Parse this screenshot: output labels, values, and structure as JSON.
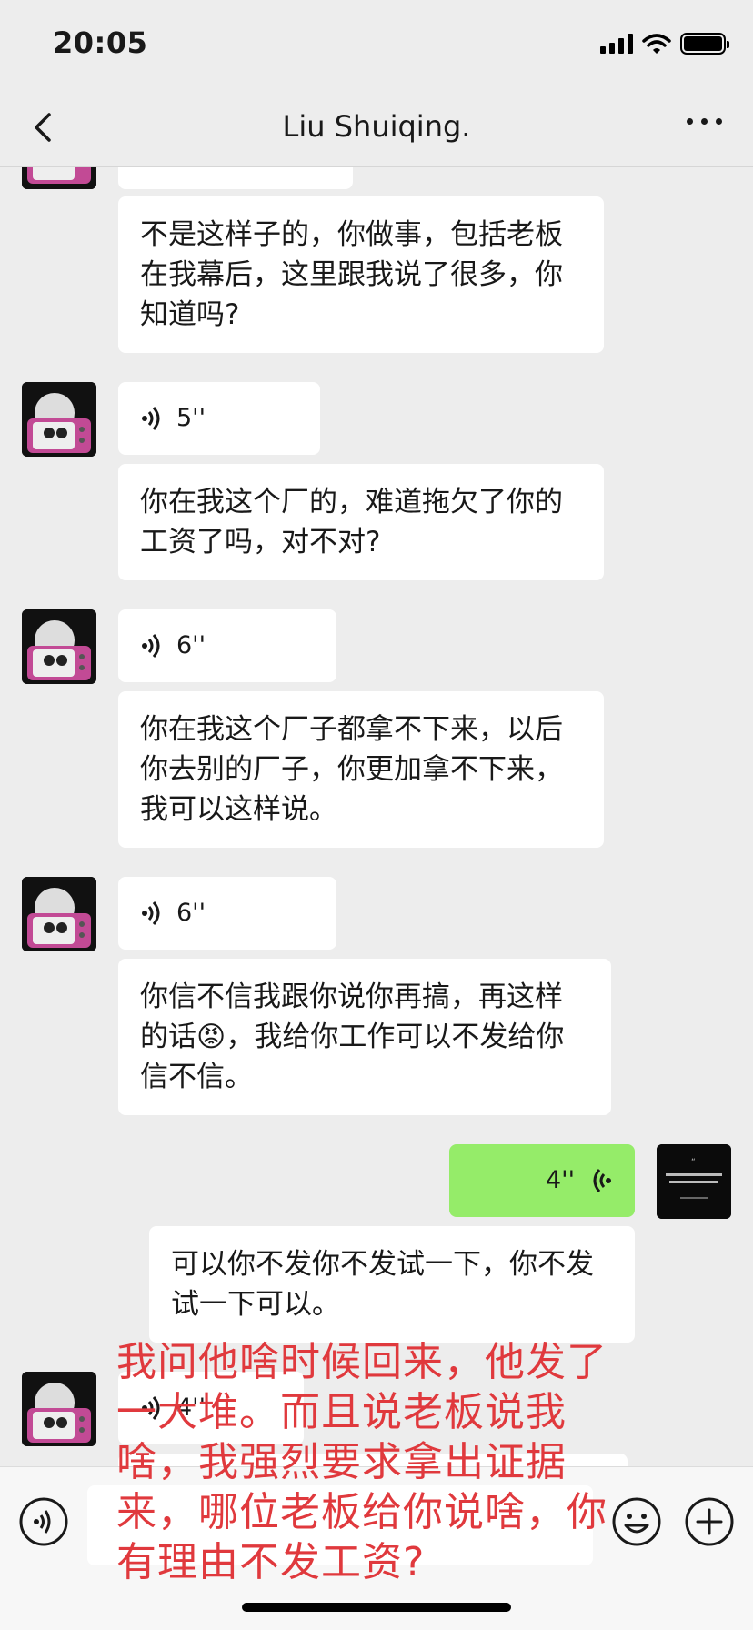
{
  "status": {
    "time": "20:05"
  },
  "header": {
    "title": "Liu Shuiqing."
  },
  "messages": [
    {
      "text": "不是这样子的，你做事，包括老板在我幕后，这里跟我说了很多，你知道吗?"
    },
    {
      "voice": "5''"
    },
    {
      "text": "你在我这个厂的，难道拖欠了你的工资了吗，对不对?"
    },
    {
      "voice": "6''"
    },
    {
      "text": "你在我这个厂子都拿不下来，以后你去别的厂子，你更加拿不下来，我可以这样说。"
    },
    {
      "voice": "6''"
    },
    {
      "text_a": "你信不信我跟你说你再搞，再这样的话",
      "emoji": "😡",
      "text_b": "，我给你工作可以不发给你信不信。"
    },
    {
      "voice": "4''"
    },
    {
      "text": "可以你不发你不发试一下，你不发试一下可以。"
    },
    {
      "voice": "4''"
    }
  ],
  "overlay_note": "我问他啥时候回来，他发了一大堆。而且说老板说我啥，我强烈要求拿出证据来，哪位老板给你说啥，你有理由不发工资?",
  "icons": [
    "back-icon",
    "more-icon",
    "voice-icon",
    "emoji-icon",
    "plus-icon",
    "signal-icon",
    "wifi-icon",
    "battery-icon"
  ]
}
